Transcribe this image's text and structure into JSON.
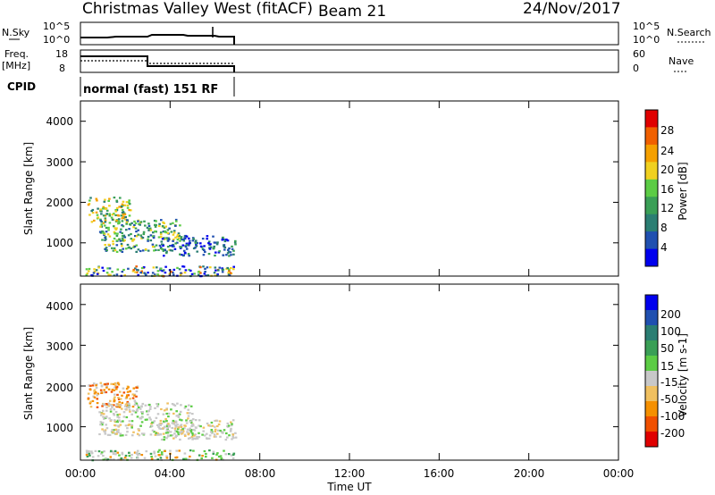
{
  "header": {
    "station": "Christmas Valley West (fitACF)",
    "beam": "Beam 21",
    "date": "24/Nov/2017"
  },
  "nsky_panel": {
    "left_label": "N.Sky",
    "right_label": "N.Search",
    "left_ticks": [
      "10^5",
      "10^0"
    ],
    "right_ticks": [
      "10^5",
      "10^0"
    ]
  },
  "freq_panel": {
    "left_label_1": "Freq.",
    "left_label_2": "[MHz]",
    "right_label": "Nave",
    "left_ticks": [
      "18",
      "8"
    ],
    "right_ticks": [
      "60",
      "0"
    ]
  },
  "cpid": {
    "label": "CPID",
    "value": "normal (fast) 151 RF"
  },
  "colors": {
    "power_scale": [
      "#0000ee",
      "#2050b0",
      "#2b7e73",
      "#3a9f56",
      "#5ccc45",
      "#f0d020",
      "#f5a000",
      "#f06000",
      "#e00000"
    ],
    "velocity_scale": [
      "#e00000",
      "#f05000",
      "#f59000",
      "#f0c060",
      "#c8c8c8",
      "#5ccc45",
      "#3a9f56",
      "#2b7e73",
      "#2050b0",
      "#0000ee"
    ]
  },
  "chart_data": [
    {
      "type": "heatmap",
      "panel": "power",
      "ylabel": "Slant Range [km]",
      "ylim": [
        180,
        4500
      ],
      "yticks": [
        "4000",
        "3000",
        "2000",
        "1000"
      ],
      "xlim": [
        "00:00",
        "24:00"
      ],
      "colorbar_label": "Power [dB]",
      "colorbar_ticks": [
        "28",
        "24",
        "20",
        "16",
        "12",
        "8",
        "4"
      ],
      "scatter_regions": [
        {
          "t0": 0.3,
          "t1": 2.2,
          "r0": 1500,
          "r1": 2150,
          "level": "high"
        },
        {
          "t0": 0.8,
          "t1": 4.5,
          "r0": 1050,
          "r1": 1600,
          "level": "mid"
        },
        {
          "t0": 1.0,
          "t1": 4.0,
          "r0": 800,
          "r1": 1000,
          "level": "mid"
        },
        {
          "t0": 3.5,
          "t1": 6.9,
          "r0": 700,
          "r1": 1200,
          "level": "low"
        },
        {
          "t0": 0.2,
          "t1": 6.9,
          "r0": 200,
          "r1": 450,
          "level": "mixed"
        }
      ]
    },
    {
      "type": "heatmap",
      "panel": "velocity",
      "ylabel": "Slant Range [km]",
      "ylim": [
        180,
        4500
      ],
      "yticks": [
        "4000",
        "3000",
        "2000",
        "1000"
      ],
      "xlabel": "Time UT",
      "xticks": [
        "00:00",
        "04:00",
        "08:00",
        "12:00",
        "16:00",
        "20:00",
        "00:00"
      ],
      "colorbar_label": "Velocity [m s-1]",
      "colorbar_ticks": [
        "200",
        "100",
        "50",
        "15",
        "-15",
        "-50",
        "-100",
        "-200"
      ],
      "scatter_regions": [
        {
          "t0": 0.3,
          "t1": 2.5,
          "r0": 1500,
          "r1": 2100,
          "level": "neg"
        },
        {
          "t0": 0.8,
          "t1": 5.0,
          "r0": 800,
          "r1": 1600,
          "level": "zero"
        },
        {
          "t0": 3.5,
          "t1": 6.9,
          "r0": 700,
          "r1": 1200,
          "level": "zero"
        },
        {
          "t0": 0.2,
          "t1": 6.9,
          "r0": 200,
          "r1": 450,
          "level": "mixed"
        }
      ]
    }
  ]
}
